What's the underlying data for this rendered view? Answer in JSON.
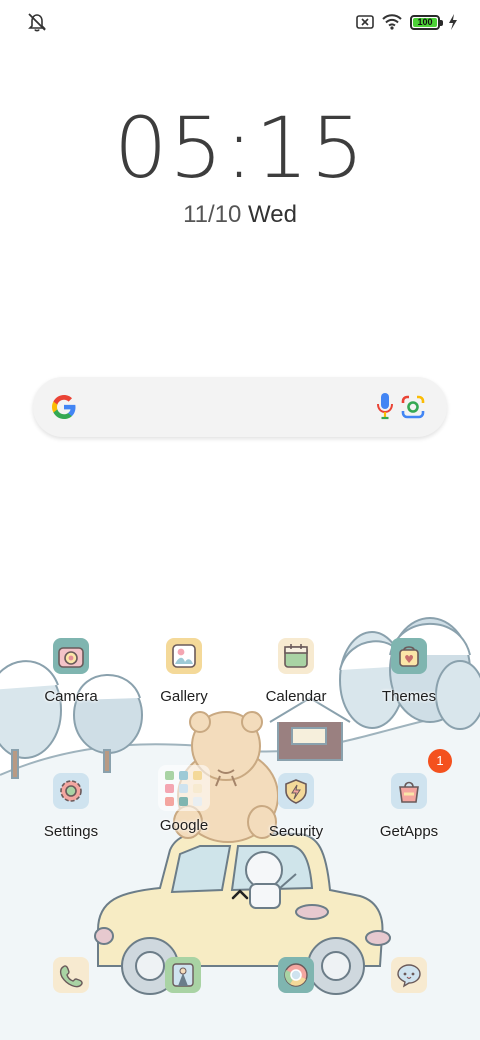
{
  "status_bar": {
    "left_icon": "bell-off-icon",
    "right_icons": [
      "no-sim-icon",
      "wifi-icon",
      "battery-icon",
      "charging-bolt-icon"
    ],
    "battery_level": "100"
  },
  "lockscreen": {
    "time": "05:15",
    "date_numeric": "11/10",
    "date_day": "Wed"
  },
  "search_bar": {
    "logo": "google-g-icon",
    "mic": "microphone-icon",
    "lens": "google-lens-icon"
  },
  "apps": [
    {
      "label": "Camera",
      "icon": "camera-icon"
    },
    {
      "label": "Gallery",
      "icon": "gallery-icon"
    },
    {
      "label": "Calendar",
      "icon": "calendar-icon"
    },
    {
      "label": "Themes",
      "icon": "themes-icon"
    },
    {
      "label": "Settings",
      "icon": "settings-icon"
    },
    {
      "label": "Google",
      "icon": "google-folder-icon"
    },
    {
      "label": "Security",
      "icon": "security-icon"
    },
    {
      "label": "GetApps",
      "icon": "getapps-icon",
      "badge": "1"
    }
  ],
  "dock": [
    {
      "icon": "phone-icon"
    },
    {
      "icon": "contacts-icon"
    },
    {
      "icon": "chrome-icon"
    },
    {
      "icon": "messages-icon"
    }
  ],
  "colors": {
    "badge": "#f4511e",
    "battery": "#4cd137",
    "google_blue": "#4285F4",
    "google_red": "#EA4335",
    "google_yellow": "#FBBC05",
    "google_green": "#34A853"
  }
}
